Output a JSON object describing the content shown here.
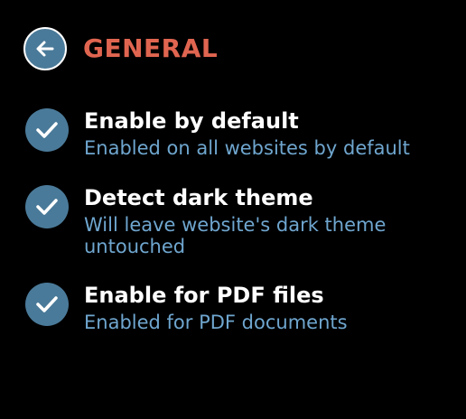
{
  "header": {
    "title": "GENERAL",
    "back_icon": "arrow-left-icon"
  },
  "options": [
    {
      "title": "Enable by default",
      "description": "Enabled on all websites by default",
      "checked": true,
      "icon": "checkmark-icon"
    },
    {
      "title": "Detect dark theme",
      "description": "Will leave website's dark theme untouched",
      "checked": true,
      "icon": "checkmark-icon"
    },
    {
      "title": "Enable for PDF files",
      "description": "Enabled for PDF documents",
      "checked": true,
      "icon": "checkmark-icon"
    }
  ],
  "colors": {
    "background": "#000000",
    "title": "#e06550",
    "accent": "#4a7a99",
    "description": "#6fa6cf",
    "text": "#ffffff"
  }
}
